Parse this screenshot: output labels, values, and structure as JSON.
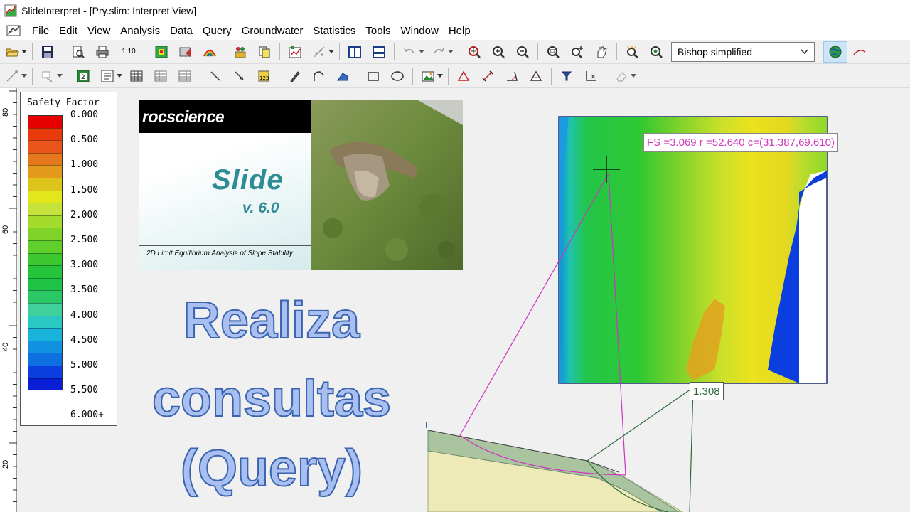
{
  "window": {
    "title": "SlideInterpret - [Pry.slim: Interpret View]"
  },
  "menu": {
    "items": [
      "File",
      "Edit",
      "View",
      "Analysis",
      "Data",
      "Query",
      "Groundwater",
      "Statistics",
      "Tools",
      "Window",
      "Help"
    ]
  },
  "toolbar": {
    "scale_label": "1:10",
    "method_selected": "Bishop simplified"
  },
  "ruler": {
    "ticks": [
      "80",
      "60",
      "40",
      "20"
    ]
  },
  "legend": {
    "title": "Safety Factor",
    "labels": [
      "0.000",
      "0.500",
      "1.000",
      "1.500",
      "2.000",
      "2.500",
      "3.000",
      "3.500",
      "4.000",
      "4.500",
      "5.000",
      "5.500",
      "6.000+"
    ],
    "colors": [
      "#e60000",
      "#e83a0a",
      "#e8541a",
      "#e4761b",
      "#e49a1c",
      "#dcc41a",
      "#e4e61c",
      "#c5e33a",
      "#a4dc2e",
      "#7fd329",
      "#5ecf2b",
      "#3ec82f",
      "#24c53a",
      "#1fc447",
      "#2ac864",
      "#3fd09c",
      "#2ac8c2",
      "#18b4dc",
      "#1192e0",
      "#0e6fe0",
      "#0a3ede",
      "#0a1ed8"
    ]
  },
  "splash": {
    "brand": "rocscience",
    "product": "Slide",
    "version": "v.  6.0",
    "subtitle": "2D Limit Equilibrium Analysis of Slope Stability"
  },
  "overlay": {
    "line1": "Realiza",
    "line2": "consultas",
    "line3": "(Query)"
  },
  "query": {
    "fs_readout": "FS =3.069 r =52.640 c=(31.387,69.610)",
    "min_fs": "1.308"
  }
}
